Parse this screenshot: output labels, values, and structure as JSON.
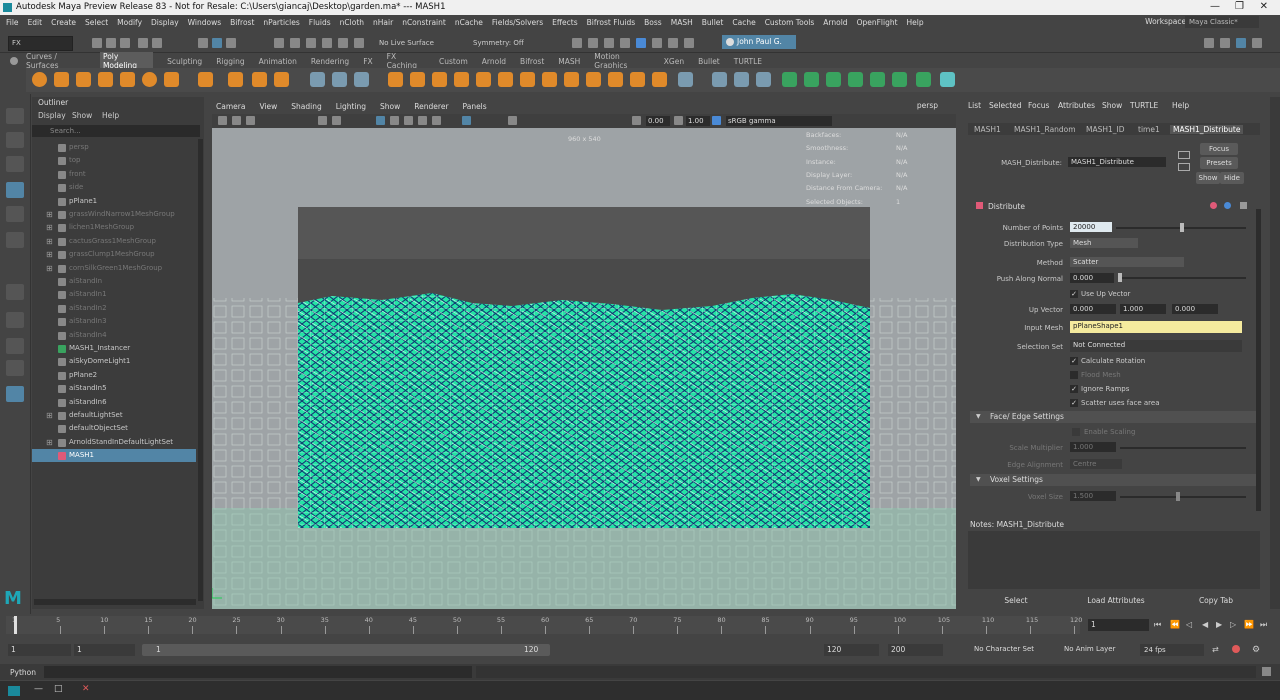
{
  "window": {
    "title": "Autodesk Maya Preview Release 83 - Not for Resale: C:\\Users\\giancaj\\Desktop\\garden.ma*   ---   MASH1",
    "controls": [
      "—",
      "❐",
      "✕"
    ]
  },
  "menubar": {
    "items": [
      "File",
      "Edit",
      "Create",
      "Select",
      "Modify",
      "Display",
      "Windows",
      "Bifrost",
      "nParticles",
      "Fluids",
      "nCloth",
      "nHair",
      "nConstraint",
      "nCache",
      "Fields/Solvers",
      "Effects",
      "Bifrost Fluids",
      "Boss",
      "MASH",
      "Bullet",
      "Cache",
      "Custom Tools",
      "Arnold",
      "OpenFlight",
      "Help"
    ],
    "workspace_label": "Workspace :",
    "workspace_value": "Maya Classic*"
  },
  "statusline": {
    "menuset": "FX",
    "live_surface": "No Live Surface",
    "symmetry": "Symmetry: Off",
    "user": "John Paul G."
  },
  "shelf": {
    "tabs": [
      "Curves / Surfaces",
      "Poly Modeling",
      "Sculpting",
      "Rigging",
      "Animation",
      "Rendering",
      "FX",
      "FX Caching",
      "Custom",
      "Arnold",
      "Bifrost",
      "MASH",
      "Motion Graphics",
      "XGen",
      "Bullet",
      "TURTLE"
    ],
    "active_tab": "Poly Modeling"
  },
  "outliner": {
    "title": "Outliner",
    "menu": [
      "Display",
      "Show",
      "Help"
    ],
    "search_placeholder": "Search...",
    "items": [
      {
        "label": "persp",
        "dim": true,
        "expand": false
      },
      {
        "label": "top",
        "dim": true,
        "expand": false
      },
      {
        "label": "front",
        "dim": true,
        "expand": false
      },
      {
        "label": "side",
        "dim": true,
        "expand": false
      },
      {
        "label": "pPlane1",
        "dim": false,
        "expand": false
      },
      {
        "label": "grassWindNarrow1MeshGroup",
        "dim": true,
        "expand": true
      },
      {
        "label": "lichen1MeshGroup",
        "dim": true,
        "expand": true
      },
      {
        "label": "cactusGrass1MeshGroup",
        "dim": true,
        "expand": true
      },
      {
        "label": "grassClump1MeshGroup",
        "dim": true,
        "expand": true
      },
      {
        "label": "cornSilkGreen1MeshGroup",
        "dim": true,
        "expand": true
      },
      {
        "label": "aiStandIn",
        "dim": true,
        "expand": false
      },
      {
        "label": "aiStandIn1",
        "dim": true,
        "expand": false
      },
      {
        "label": "aiStandIn2",
        "dim": true,
        "expand": false
      },
      {
        "label": "aiStandIn3",
        "dim": true,
        "expand": false
      },
      {
        "label": "aiStandIn4",
        "dim": true,
        "expand": false
      },
      {
        "label": "MASH1_Instancer",
        "dim": false,
        "expand": false
      },
      {
        "label": "aiSkyDomeLight1",
        "dim": false,
        "expand": false
      },
      {
        "label": "pPlane2",
        "dim": false,
        "expand": false
      },
      {
        "label": "aiStandIn5",
        "dim": false,
        "expand": false
      },
      {
        "label": "aiStandIn6",
        "dim": false,
        "expand": false
      },
      {
        "label": "defaultLightSet",
        "dim": false,
        "expand": true
      },
      {
        "label": "defaultObjectSet",
        "dim": false,
        "expand": false
      },
      {
        "label": "ArnoldStandInDefaultLightSet",
        "dim": false,
        "expand": true
      },
      {
        "label": "MASH1",
        "dim": false,
        "expand": false,
        "selected": true
      }
    ]
  },
  "viewport": {
    "menu": [
      "Camera",
      "View",
      "Shading",
      "Lighting",
      "Show",
      "Renderer",
      "Panels"
    ],
    "camera_name": "persp",
    "resolution": "960 x 540",
    "field1": "0.00",
    "field2": "1.00",
    "colorspace": "sRGB gamma",
    "hud": [
      {
        "label": "Backfaces:",
        "value": "N/A"
      },
      {
        "label": "Smoothness:",
        "value": "N/A"
      },
      {
        "label": "Instance:",
        "value": "N/A"
      },
      {
        "label": "Display Layer:",
        "value": "N/A"
      },
      {
        "label": "Distance From Camera:",
        "value": "N/A"
      },
      {
        "label": "Selected Objects:",
        "value": "1"
      }
    ]
  },
  "attribute_editor": {
    "menu": [
      "List",
      "Selected",
      "Focus",
      "Attributes",
      "Show",
      "TURTLE",
      "Help"
    ],
    "tabs": [
      "MASH1",
      "MASH1_Random",
      "MASH1_ID",
      "time1",
      "MASH1_Distribute"
    ],
    "active_tab": "MASH1_Distribute",
    "node_label": "MASH_Distribute:",
    "node_name": "MASH1_Distribute",
    "buttons": {
      "focus": "Focus",
      "presets": "Presets",
      "show": "Show",
      "hide": "Hide"
    },
    "section": "Distribute",
    "number_of_points_label": "Number of Points",
    "number_of_points": "20000",
    "distribution_type_label": "Distribution Type",
    "distribution_type": "Mesh",
    "method_label": "Method",
    "method": "Scatter",
    "push_along_normal_label": "Push Along Normal",
    "push_along_normal": "0.000",
    "use_up_vector": "Use Up Vector",
    "up_vector_label": "Up Vector",
    "up_vector": [
      "0.000",
      "1.000",
      "0.000"
    ],
    "input_mesh_label": "Input Mesh",
    "input_mesh": "pPlaneShape1",
    "selection_set_label": "Selection Set",
    "selection_set": "Not Connected",
    "checkboxes": [
      {
        "label": "Calculate Rotation",
        "checked": true
      },
      {
        "label": "Flood Mesh",
        "checked": false
      },
      {
        "label": "Ignore Ramps",
        "checked": true
      },
      {
        "label": "Scatter uses face area",
        "checked": true
      }
    ],
    "face_edge_section": "Face/ Edge Settings",
    "enable_scaling": "Enable Scaling",
    "scale_multiplier_label": "Scale Multiplier",
    "scale_multiplier": "1.000",
    "edge_alignment_label": "Edge Alignment",
    "edge_alignment": "Centre",
    "voxel_section": "Voxel Settings",
    "voxel_size_label": "Voxel Size",
    "voxel_size": "1.500",
    "notes": "Notes: MASH1_Distribute",
    "bottom_buttons": [
      "Select",
      "Load Attributes",
      "Copy Tab"
    ]
  },
  "timeslider": {
    "ticks": [
      "1",
      "5",
      "10",
      "15",
      "20",
      "25",
      "30",
      "35",
      "40",
      "45",
      "50",
      "55",
      "60",
      "65",
      "70",
      "75",
      "80",
      "85",
      "90",
      "95",
      "100",
      "105",
      "110",
      "115",
      "120"
    ],
    "current_frame": "1",
    "start": "1",
    "start2": "1",
    "range_start": "1",
    "range_end": "120",
    "end": "120",
    "end2": "200",
    "character_set": "No Character Set",
    "anim_layer": "No Anim Layer",
    "fps": "24 fps"
  },
  "cmdline": {
    "label": "Python"
  }
}
